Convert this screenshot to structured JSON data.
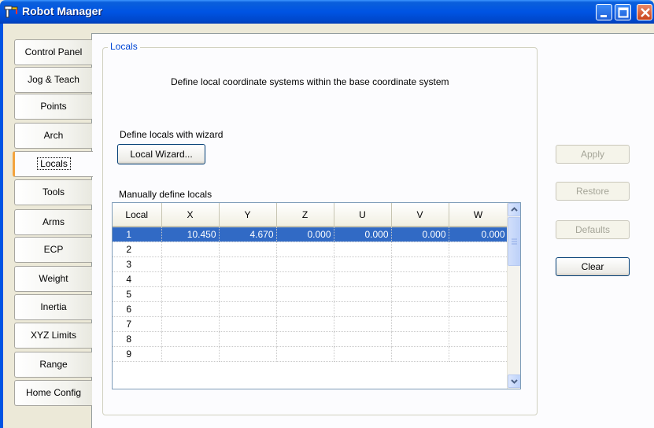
{
  "window": {
    "title": "Robot Manager"
  },
  "tabs": [
    {
      "label": "Control Panel"
    },
    {
      "label": "Jog & Teach"
    },
    {
      "label": "Points"
    },
    {
      "label": "Arch"
    },
    {
      "label": "Locals",
      "active": true
    },
    {
      "label": "Tools"
    },
    {
      "label": "Arms"
    },
    {
      "label": "ECP"
    },
    {
      "label": "Weight"
    },
    {
      "label": "Inertia"
    },
    {
      "label": "XYZ Limits"
    },
    {
      "label": "Range"
    },
    {
      "label": "Home Config"
    }
  ],
  "locals": {
    "group_title": "Locals",
    "description": "Define local coordinate systems within the base coordinate system",
    "wizard_label": "Define locals with wizard",
    "wizard_button": "Local Wizard...",
    "manual_label": "Manually define locals",
    "grid": {
      "columns": [
        "Local",
        "X",
        "Y",
        "Z",
        "U",
        "V",
        "W"
      ],
      "rows": [
        [
          "1",
          "10.450",
          "4.670",
          "0.000",
          "0.000",
          "0.000",
          "0.000"
        ],
        [
          "2",
          "",
          "",
          "",
          "",
          "",
          ""
        ],
        [
          "3",
          "",
          "",
          "",
          "",
          "",
          ""
        ],
        [
          "4",
          "",
          "",
          "",
          "",
          "",
          ""
        ],
        [
          "5",
          "",
          "",
          "",
          "",
          "",
          ""
        ],
        [
          "6",
          "",
          "",
          "",
          "",
          "",
          ""
        ],
        [
          "7",
          "",
          "",
          "",
          "",
          "",
          ""
        ],
        [
          "8",
          "",
          "",
          "",
          "",
          "",
          ""
        ],
        [
          "9",
          "",
          "",
          "",
          "",
          "",
          ""
        ]
      ],
      "selected_row": 1
    }
  },
  "buttons": {
    "apply": "Apply",
    "restore": "Restore",
    "defaults": "Defaults",
    "clear": "Clear"
  },
  "colors": {
    "titlebar": "#0054e3",
    "selection": "#316ac5",
    "group_title": "#0046d5",
    "active_tab_marker": "#f3a33d"
  }
}
